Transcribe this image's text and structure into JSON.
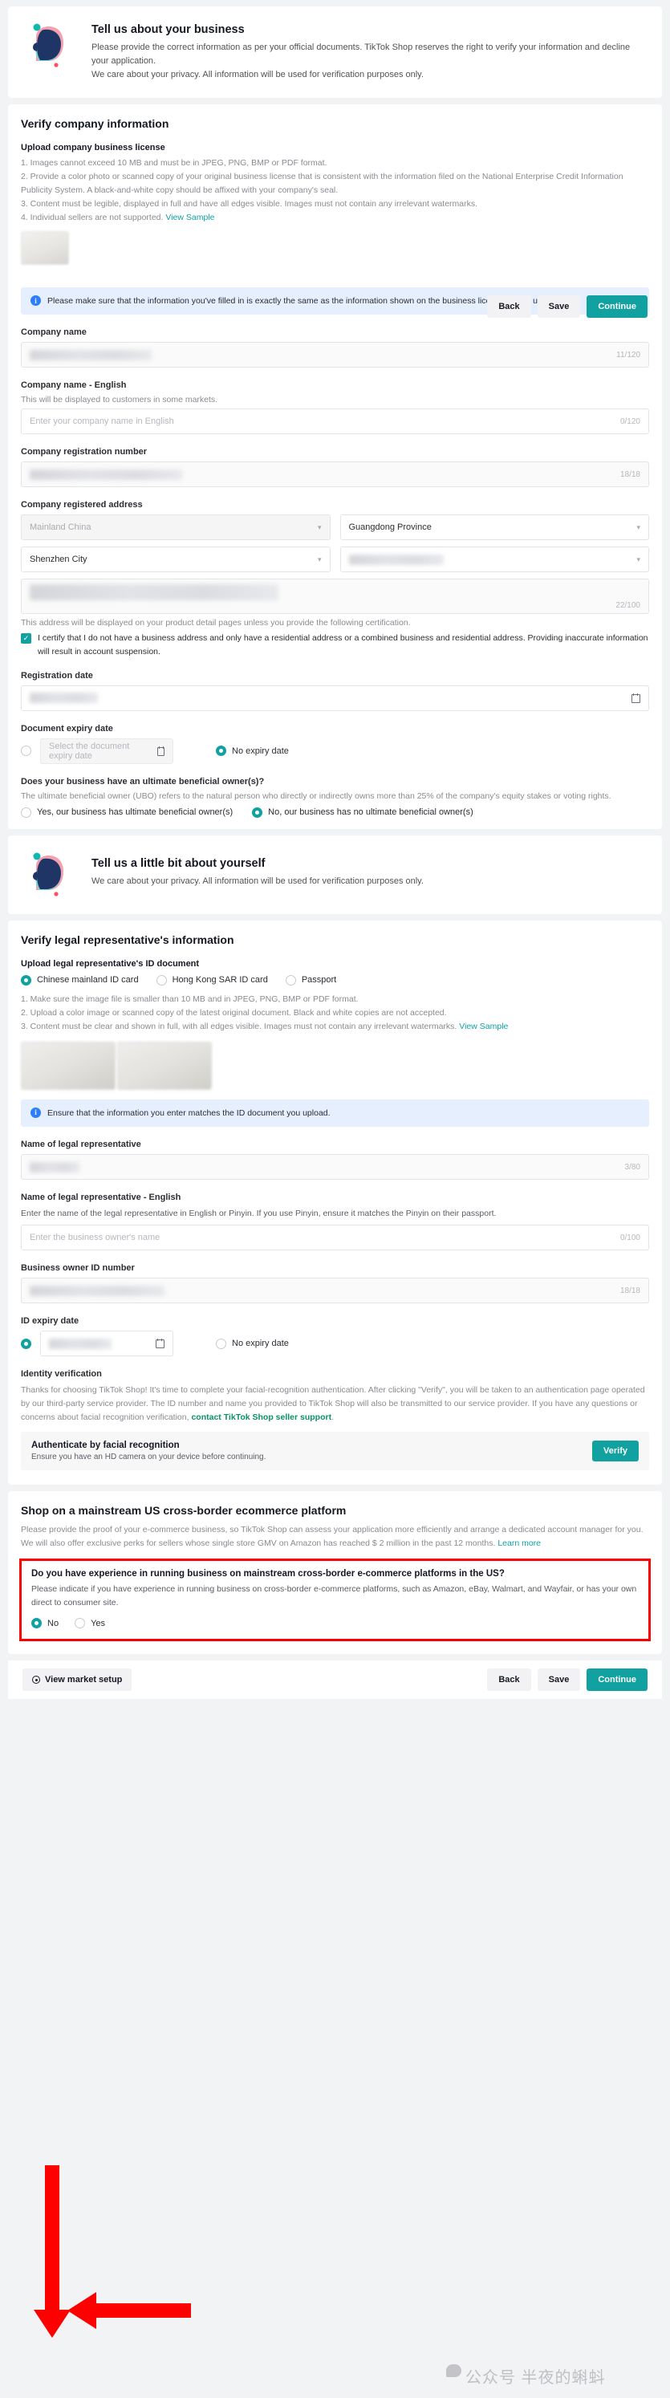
{
  "intro": {
    "title": "Tell us about your business",
    "line1": "Please provide the correct information as per your official documents. TikTok Shop reserves the right to verify your information and decline your application.",
    "line2": "We care about your privacy. All information will be used for verification purposes only."
  },
  "company_section": {
    "title": "Verify company information",
    "upload_label": "Upload company business license",
    "rules": [
      "1. Images cannot exceed 10 MB and must be in JPEG, PNG, BMP or PDF format.",
      "2. Provide a color photo or scanned copy of your original business license that is consistent with the information filed on the National Enterprise Credit Information Publicity System. A black-and-white copy should be affixed with your company's seal.",
      "3. Content must be legible, displayed in full and have all edges visible. Images must not contain any irrelevant watermarks.",
      "4. Individual sellers are not supported."
    ],
    "view_sample": "View Sample",
    "info_banner": "Please make sure that the information you've filled in is exactly the same as the information shown on the business license you've uploaded.",
    "company_name_label": "Company name",
    "company_name_counter": "11/120",
    "company_name_en_label": "Company name - English",
    "company_name_en_help": "This will be displayed to customers in some markets.",
    "company_name_en_placeholder": "Enter your company name in English",
    "company_name_en_counter": "0/120",
    "reg_number_label": "Company registration number",
    "reg_number_counter": "18/18",
    "address_label": "Company registered address",
    "address_country": "Mainland China",
    "address_province": "Guangdong Province",
    "address_city": "Shenzhen City",
    "address_district": "",
    "address_detail_counter": "22/100",
    "address_note": "This address will be displayed on your product detail pages unless you provide the following certification.",
    "address_certify": "I certify that I do not have a business address and only have a residential address or a combined business and residential address. Providing inaccurate information will result in account suspension.",
    "registration_date_label": "Registration date",
    "doc_expiry_label": "Document expiry date",
    "doc_expiry_placeholder": "Select the document expiry date",
    "no_expiry_label": "No expiry date",
    "ubo_question": "Does your business have an ultimate beneficial owner(s)?",
    "ubo_help": "The ultimate beneficial owner (UBO) refers to the natural person who directly or indirectly owns more than 25% of the company's equity stakes or voting rights.",
    "ubo_yes": "Yes, our business has ultimate beneficial owner(s)",
    "ubo_no": "No, our business has no ultimate beneficial owner(s)"
  },
  "actions": {
    "back": "Back",
    "save": "Save",
    "continue": "Continue"
  },
  "self_intro": {
    "title": "Tell us a little bit about yourself",
    "desc": "We care about your privacy. All information will be used for verification purposes only."
  },
  "legal_section": {
    "title": "Verify legal representative's information",
    "upload_label": "Upload legal representative's ID document",
    "id_types": [
      "Chinese mainland ID card",
      "Hong Kong SAR ID card",
      "Passport"
    ],
    "rules": [
      "1. Make sure the image file is smaller than 10 MB and in JPEG, PNG, BMP or PDF format.",
      "2. Upload a color image or scanned copy of the latest original document. Black and white copies are not accepted.",
      "3. Content must be clear and shown in full, with all edges visible. Images must not contain any irrelevant watermarks."
    ],
    "view_sample": "View Sample",
    "id_banner": "Ensure that the information you enter matches the ID document you upload.",
    "name_label": "Name of legal representative",
    "name_counter": "3/80",
    "name_en_label": "Name of legal representative - English",
    "name_en_help": "Enter the name of the legal representative in English or Pinyin. If you use Pinyin, ensure it matches the Pinyin on their passport.",
    "name_en_placeholder": "Enter the business owner's name",
    "name_en_counter": "0/100",
    "owner_id_label": "Business owner ID number",
    "owner_id_counter": "18/18",
    "id_expiry_label": "ID expiry date",
    "no_expiry_label": "No expiry date",
    "identity_verification_label": "Identity verification",
    "identity_desc_1": "Thanks for choosing TikTok Shop! It's time to complete your facial-recognition authentication. After clicking \"Verify\", you will be taken to an authentication page operated by our third-party service provider. The ID number and name you provided to TikTok Shop will also be transmitted to our service provider. If you have any questions or concerns about facial recognition verification, ",
    "identity_link": "contact TikTok Shop seller support",
    "identity_desc_2": ".",
    "face_title": "Authenticate by facial recognition",
    "face_desc": "Ensure you have an HD camera on your device before continuing.",
    "verify_button": "Verify"
  },
  "platform_section": {
    "title": "Shop on a mainstream US cross-border ecommerce platform",
    "desc": "Please provide the proof of your e-commerce business, so TikTok Shop can assess your application more efficiently and arrange a dedicated account manager for you. We will also offer exclusive perks for sellers whose single store GMV on Amazon has reached $ 2 million in the past 12 months. ",
    "learn_more": "Learn more",
    "question": "Do you have experience in running business on mainstream cross-border e-commerce platforms in the US?",
    "question_help": "Please indicate if you have experience in running business on cross-border e-commerce platforms, such as Amazon, eBay, Walmart, and Wayfair, or has your own direct to consumer site.",
    "option_no": "No",
    "option_yes": "Yes"
  },
  "footer": {
    "market_setup": "View market setup",
    "back": "Back",
    "save": "Save",
    "continue": "Continue"
  },
  "watermark": "公众号 半夜的蝌蚪",
  "colors": {
    "accent": "#12a1a1",
    "info_bg": "#e5effd",
    "highlight": "#ff0000",
    "link_green": "#0a9269"
  }
}
